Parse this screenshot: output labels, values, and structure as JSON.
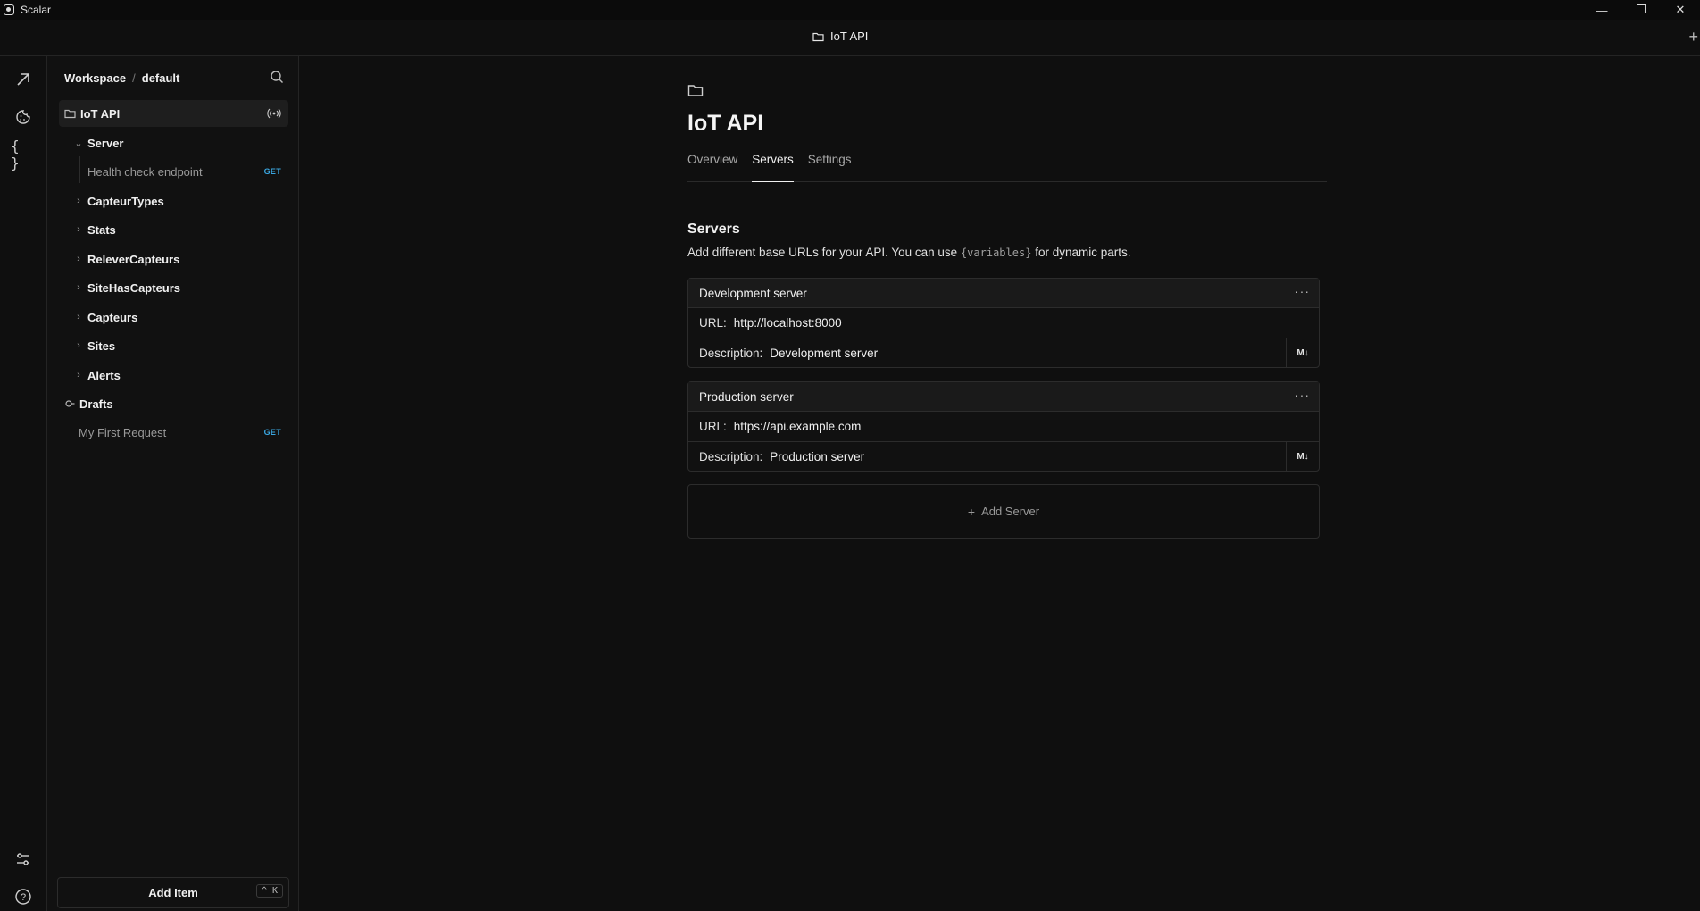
{
  "window": {
    "app_name": "Scalar",
    "minimize": "—",
    "maximize": "❐",
    "close": "✕"
  },
  "tabbar": {
    "title": "IoT API",
    "new_tab": "+"
  },
  "sidebar": {
    "workspace_label": "Workspace",
    "separator": "/",
    "workspace_name": "default",
    "collection": {
      "label": "IoT API"
    },
    "items": [
      {
        "label": "Server",
        "expanded": true
      },
      {
        "label": "Health check endpoint",
        "method": "GET"
      },
      {
        "label": "CapteurTypes"
      },
      {
        "label": "Stats"
      },
      {
        "label": "ReleverCapteurs"
      },
      {
        "label": "SiteHasCapteurs"
      },
      {
        "label": "Capteurs"
      },
      {
        "label": "Sites"
      },
      {
        "label": "Alerts"
      }
    ],
    "drafts": {
      "label": "Drafts",
      "request": {
        "label": "My First Request",
        "method": "GET"
      }
    },
    "add_item": {
      "label": "Add Item",
      "shortcut": "^ K"
    }
  },
  "main": {
    "title": "IoT API",
    "tabs": [
      {
        "label": "Overview"
      },
      {
        "label": "Servers"
      },
      {
        "label": "Settings"
      }
    ],
    "section_title": "Servers",
    "section_desc_pre": "Add different base URLs for your API. You can use ",
    "section_desc_code": "{variables}",
    "section_desc_post": " for dynamic parts.",
    "servers": [
      {
        "name": "Development server",
        "url_label": "URL:",
        "url": "http://localhost:8000",
        "desc_label": "Description:",
        "description": "Development server",
        "md": "M↓"
      },
      {
        "name": "Production server",
        "url_label": "URL:",
        "url": "https://api.example.com",
        "desc_label": "Description:",
        "description": "Production server",
        "md": "M↓"
      }
    ],
    "add_server": "Add Server"
  }
}
